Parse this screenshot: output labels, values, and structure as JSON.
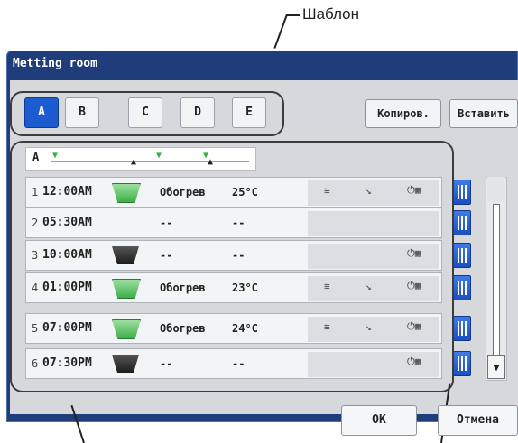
{
  "callout": {
    "label": "Шаблон"
  },
  "window": {
    "title": "Metting room"
  },
  "templates": {
    "tabs": [
      "A",
      "B",
      "C",
      "D",
      "E"
    ]
  },
  "toolbar": {
    "copy_label": "Копиров.",
    "paste_label": "Вставить"
  },
  "timeline": {
    "letter": "A"
  },
  "schedule": [
    {
      "num": "1",
      "time": "12:00AM",
      "fan": "on",
      "mode": "Обогрев",
      "temp": "25°C"
    },
    {
      "num": "2",
      "time": "05:30AM",
      "fan": "none",
      "mode": "--",
      "temp": "--"
    },
    {
      "num": "3",
      "time": "10:00AM",
      "fan": "off",
      "mode": "--",
      "temp": "--"
    },
    {
      "num": "4",
      "time": "01:00PM",
      "fan": "on",
      "mode": "Обогрев",
      "temp": "23°C"
    },
    {
      "num": "5",
      "time": "07:00PM",
      "fan": "on",
      "mode": "Обогрев",
      "temp": "24°C"
    },
    {
      "num": "6",
      "time": "07:30PM",
      "fan": "off",
      "mode": "--",
      "temp": "--"
    }
  ],
  "footer": {
    "ok_label": "OK",
    "cancel_label": "Отмена"
  }
}
